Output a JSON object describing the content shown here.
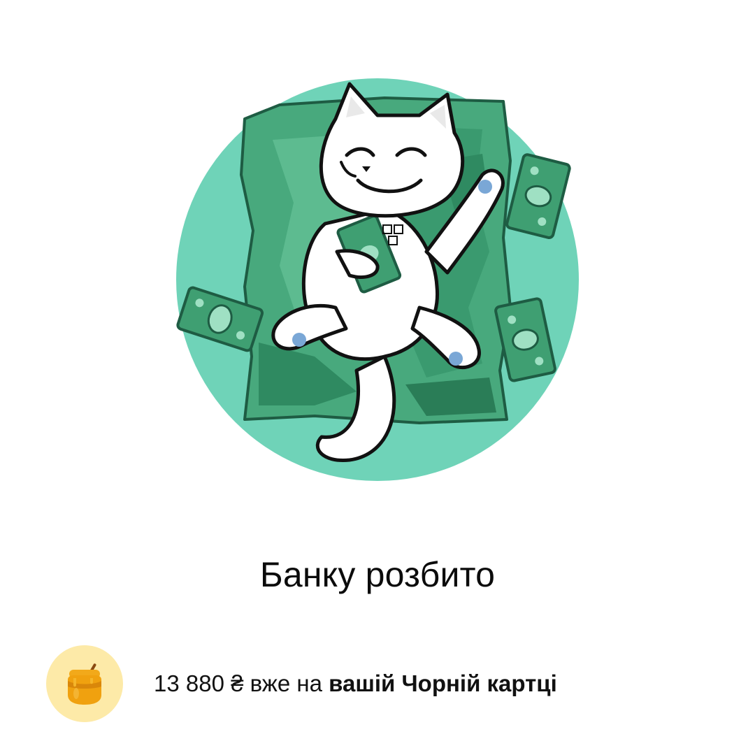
{
  "hero": {
    "illustration": "cat-lying-on-banknotes-illustration",
    "circle_color": "#6fd3b8",
    "money_color": "#3f9f72",
    "money_dark": "#1f6e4c"
  },
  "title": "Банку розбито",
  "info": {
    "icon": "honey-jar-icon",
    "badge_color": "#fdeaa8",
    "amount": "13 880 ₴",
    "middle": " вже на ",
    "card": "вашій Чорній картці"
  }
}
